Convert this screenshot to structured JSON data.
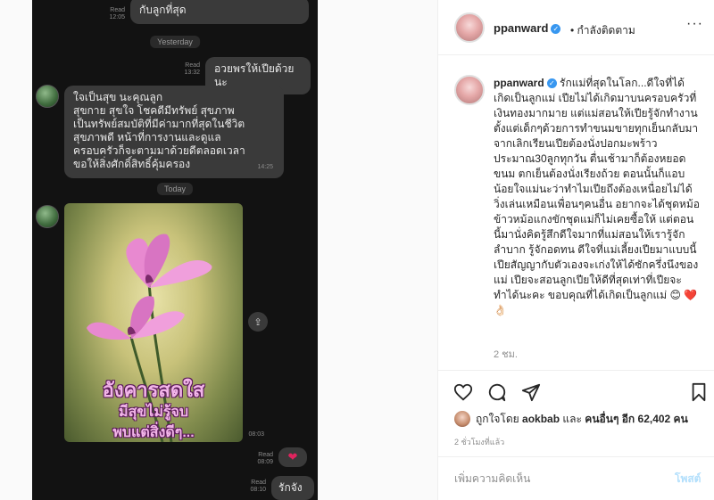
{
  "chat": {
    "top_message": "กับลูกที่สุด",
    "top_meta": "Read\n12:05",
    "day_yesterday": "Yesterday",
    "outgoing_1": "อวยพรให้เปียด้วยนะ",
    "outgoing_1_meta": "Read\n13:32",
    "incoming_lines": [
      "ใจเป็นสุข นะคุณลูก",
      "สุขกาย สุขใจ โชคดีมีทรัพย์ สุขภาพ",
      "เป็นทรัพย์สมบัติที่มีค่ามากที่สุดในชีวิต",
      "สุขภาพดี หน้าที่การงานและดูแล",
      "ครอบครัวก็จะตามมาด้วยดีตลอดเวลา",
      "ขอให้สิ่งศักดิ์สิทธิ์คุ้มครอง"
    ],
    "incoming_time": "14:25",
    "day_today": "Today",
    "photo_lines": [
      "อังคารสดใส",
      "มีสุขไม่รู้จบ",
      "พบแต่สิ่งดีๆ..."
    ],
    "photo_time": "08:03",
    "heart_meta": "Read\n08:09",
    "outgoing_2": "รักจัง",
    "outgoing_2_meta": "Read\n08:10",
    "heart_icon": "heart-icon",
    "share_icon": "share-icon"
  },
  "post": {
    "username": "ppanward",
    "follow_status": "• กำลังติดตาม",
    "more_icon": "more-icon",
    "caption_username": "ppanward",
    "caption_text": "รักแม่ที่สุดในโลก...ดีใจที่ได้เกิดเป็นลูกแม่ เปียไม่ได้เกิดมาบนครอบครัวที่เงินทองมากมาย แต่แม่สอนให้เปียรู้จักทำงานตั้งแต่เด็กๆด้วยการทำขนมขายทุกเย็นกลับมาจากเลิกเรียนเปียต้องนั่งปอกมะพร้าวประมาณ30ลูกทุกวัน ตื่นเช้ามาก็ต้องหยอดขนม ตกเย็นต้องนั่งเรียงถ้วย ตอนนั้นก็แอบน้อยใจแม่นะว่าทำไมเปียถึงต้องเหนื่อยไม่ได้วิ่งเล่นเหมือนเพื่อนๆคนอื่น อยากจะได้ชุดหม้อข้าวหม้อแกงขักชุดแม่ก็ไม่เคยซื้อให้ แต่ตอนนี้มานั่งคิดรู้สึกดีใจมากที่แม่สอนให้เรารู้จักลำบาก รู้จักอดทน ดีใจที่แม่เลี้ยงเปียมาแบบนี้ เปียสัญญากับตัวเองจะเก่งให้ได้ซักครึ่งนึงของแม่ เปียจะสอนลูกเปียให้ดีที่สุดเท่าที่เปียจะทำได้นะคะ ขอบคุณที่ได้เกิดเป็นลูกแม่ 😊 ❤️👌🏻",
    "caption_time": "2 ชม.",
    "liked_prefix": "ถูกใจโดย",
    "liked_user": "aokbab",
    "liked_and": "และ",
    "liked_others": "คนอื่นๆ อีก 62,402 คน",
    "post_time": "2 ชั่วโมงที่แล้ว",
    "comment_placeholder": "เพิ่มความคิดเห็น",
    "post_button": "โพสต์",
    "icons": [
      "heart-outline-icon",
      "comment-icon",
      "share-icon",
      "bookmark-icon"
    ]
  }
}
